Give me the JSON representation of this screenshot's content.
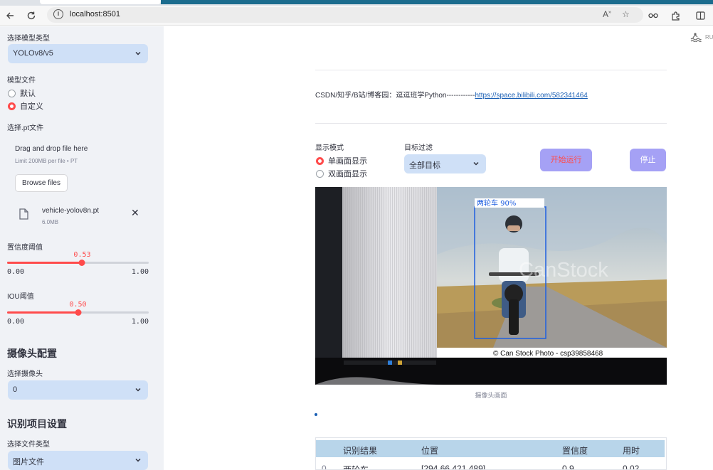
{
  "browser": {
    "url": "localhost:8501"
  },
  "sidebar": {
    "model_type_label": "选择模型类型",
    "model_type_value": "YOLOv8/v5",
    "model_file_label": "模型文件",
    "model_file_options": [
      "默认",
      "自定义"
    ],
    "model_file_selected": "自定义",
    "pt_label": "选择.pt文件",
    "uploader": {
      "drop_text": "Drag and drop file here",
      "limit_text": "Limit 200MB per file • PT",
      "browse_label": "Browse files"
    },
    "uploaded_file": {
      "name": "vehicle-yolov8n.pt",
      "size": "6.0MB"
    },
    "confidence": {
      "label": "置信度阈值",
      "value": "0.53",
      "fraction": 0.53,
      "min": "0.00",
      "max": "1.00"
    },
    "iou": {
      "label": "IOU阈值",
      "value": "0.50",
      "fraction": 0.5,
      "min": "0.00",
      "max": "1.00"
    },
    "camera_heading": "摄像头配置",
    "camera_label": "选择摄像头",
    "camera_value": "0",
    "project_heading": "识别项目设置",
    "file_type_label": "选择文件类型",
    "file_type_value": "图片文件"
  },
  "main": {
    "top_right_text": "RU",
    "link_prefix": "CSDN/知乎/B站/博客园：逗逗班学Python------------",
    "link_text": "https://space.bilibili.com/582341464",
    "display_mode_label": "显示模式",
    "display_modes": [
      "单画面显示",
      "双画面显示"
    ],
    "display_mode_selected": "单画面显示",
    "filter_label": "目标过滤",
    "filter_value": "全部目标",
    "start_button": "开始运行",
    "stop_button": "停止",
    "video": {
      "detection_label": "两轮车 90%",
      "watermark": "CanStock",
      "credit": "© Can Stock Photo - csp39858468"
    },
    "caption": "摄像头画面",
    "table": {
      "headers": [
        "识别结果",
        "位置",
        "置信度",
        "用时"
      ],
      "rows": [
        {
          "index": "0",
          "result": "两轮车",
          "position": "[294,66,421,489]",
          "confidence": "0.9",
          "time": "0.02"
        }
      ]
    }
  },
  "colors": {
    "accent": "#ff4b4b",
    "select_bg": "#cfe0f7",
    "button_bg": "#a5a1f5",
    "sidebar_bg": "#f0f2f6",
    "link": "#1a5fb4",
    "table_header": "#b8d5ea"
  }
}
